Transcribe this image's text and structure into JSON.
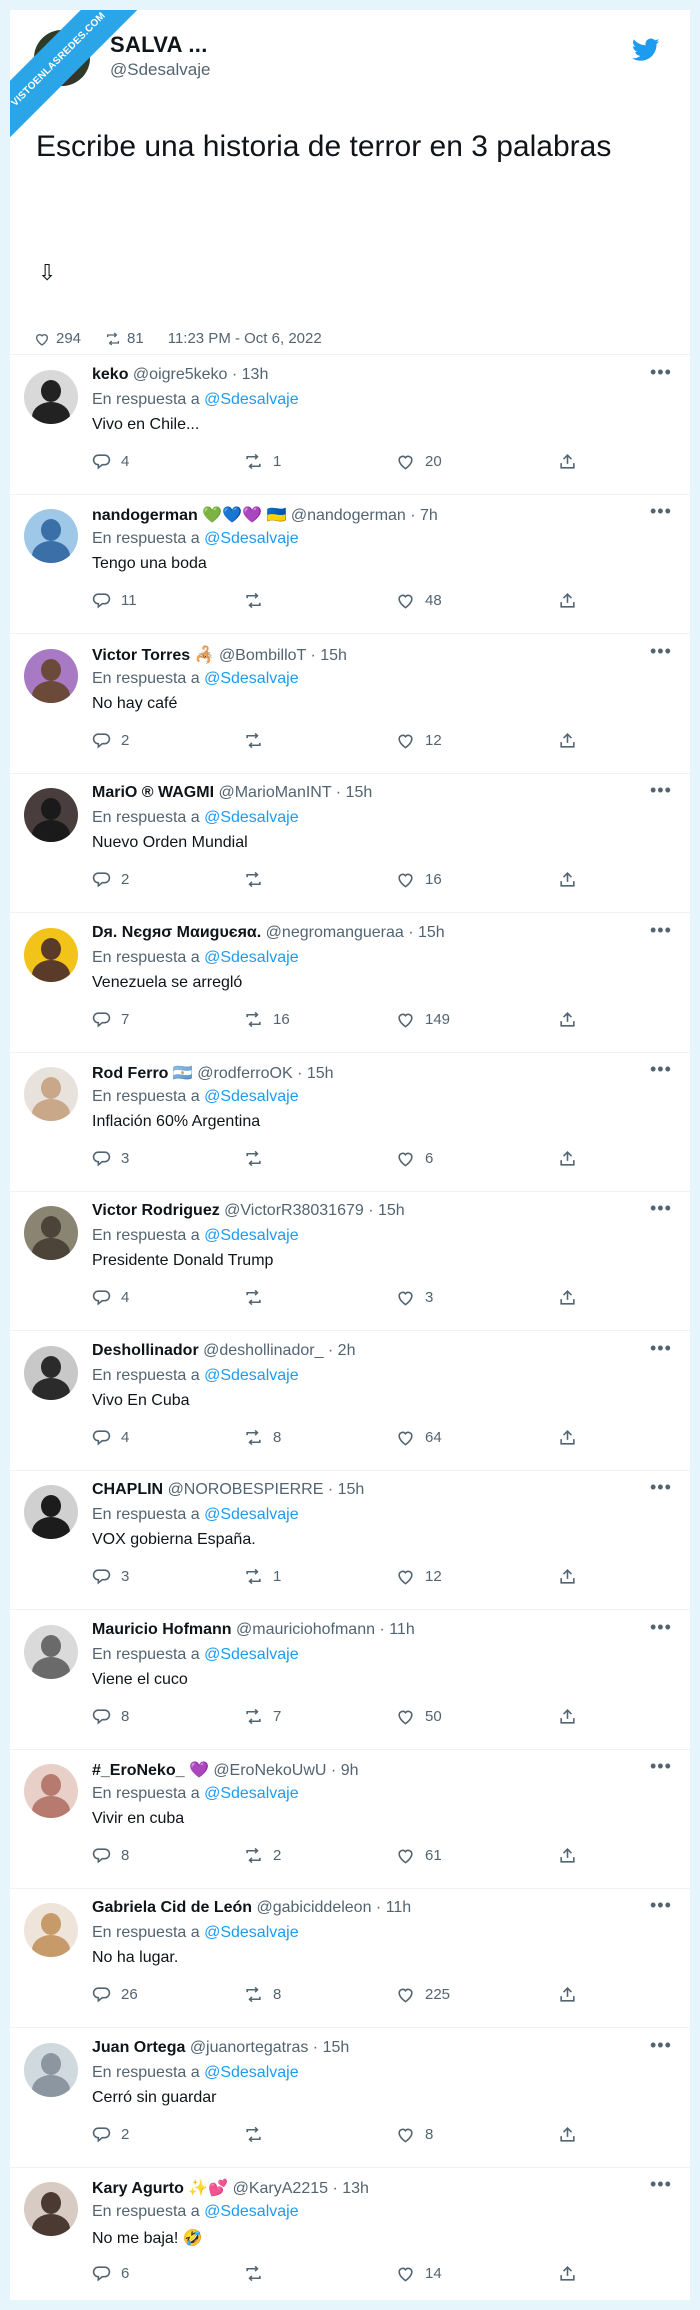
{
  "watermark": "VISTOENLASREDES.COM",
  "tweet": {
    "author_name": "SALVA ...",
    "author_handle": "@Sdesalvaje",
    "text": "Escribe una historia de terror en 3 palabras",
    "arrow": "⇩",
    "likes": "294",
    "retweets": "81",
    "timestamp": "11:23 PM - Oct 6, 2022"
  },
  "reply_prefix": "En respuesta a",
  "replies": [
    {
      "name": "keko",
      "meta": "@oigre5keko · 13h",
      "mention": "@Sdesalvaje",
      "text": "Vivo en Chile...",
      "replies": "4",
      "retweets": "1",
      "likes": "20",
      "avatar_color": "#222222",
      "avatar_bg": "#d9d9d9"
    },
    {
      "name": "nandogerman 💚💙💜 🇺🇦",
      "meta": "@nandogerman · 7h",
      "mention": "@Sdesalvaje",
      "text": "Tengo una boda",
      "replies": "11",
      "retweets": "",
      "likes": "48",
      "avatar_color": "#3a6fa8",
      "avatar_bg": "#9fc8e8"
    },
    {
      "name": "Victor Torres 🦂",
      "meta": "@BombilloT · 15h",
      "mention": "@Sdesalvaje",
      "text": "No hay café",
      "replies": "2",
      "retweets": "",
      "likes": "12",
      "avatar_color": "#6b4a3a",
      "avatar_bg": "#a97ac4"
    },
    {
      "name": "MariO ® WAGMI",
      "meta": "@MarioManINT · 15h",
      "mention": "@Sdesalvaje",
      "text": "Nuevo Orden Mundial",
      "replies": "2",
      "retweets": "",
      "likes": "16",
      "avatar_color": "#1a1a1a",
      "avatar_bg": "#4a3d3d"
    },
    {
      "name": "Dя. Nєgяσ Mαиgυєяα.",
      "meta": "@negromangueraa · 15h",
      "mention": "@Sdesalvaje",
      "text": "Venezuela se arregló",
      "replies": "7",
      "retweets": "16",
      "likes": "149",
      "avatar_color": "#5a3a28",
      "avatar_bg": "#f2c318"
    },
    {
      "name": "Rod Ferro 🇦🇷",
      "meta": "@rodferroOK · 15h",
      "mention": "@Sdesalvaje",
      "text": "Inflación 60% Argentina",
      "replies": "3",
      "retweets": "",
      "likes": "6",
      "avatar_color": "#c9a88a",
      "avatar_bg": "#e8e2dc"
    },
    {
      "name": "Victor Rodriguez",
      "meta": "@VictorR38031679 · 15h",
      "mention": "@Sdesalvaje",
      "text": "Presidente Donald Trump",
      "replies": "4",
      "retweets": "",
      "likes": "3",
      "avatar_color": "#4c4438",
      "avatar_bg": "#8a8472"
    },
    {
      "name": "Deshollinador",
      "meta": "@deshollinador_ · 2h",
      "mention": "@Sdesalvaje",
      "text": "Vivo En Cuba",
      "replies": "4",
      "retweets": "8",
      "likes": "64",
      "avatar_color": "#2b2b2b",
      "avatar_bg": "#c8c8c8"
    },
    {
      "name": "CHAPLIN",
      "meta": "@NOROBESPIERRE · 15h",
      "mention": "@Sdesalvaje",
      "text": "VOX gobierna España.",
      "replies": "3",
      "retweets": "1",
      "likes": "12",
      "avatar_color": "#1c1c1c",
      "avatar_bg": "#d0d0d0"
    },
    {
      "name": "Mauricio Hofmann",
      "meta": "@mauriciohofmann · 11h",
      "mention": "@Sdesalvaje",
      "text": "Viene el cuco",
      "replies": "8",
      "retweets": "7",
      "likes": "50",
      "avatar_color": "#6a6a6a",
      "avatar_bg": "#dadada"
    },
    {
      "name": "#_EroNeko_ 💜",
      "meta": "@EroNekoUwU · 9h",
      "mention": "@Sdesalvaje",
      "text": "Vivir en cuba",
      "replies": "8",
      "retweets": "2",
      "likes": "61",
      "avatar_color": "#b77a6e",
      "avatar_bg": "#e8cfc8"
    },
    {
      "name": "Gabriela Cid de León",
      "meta": "@gabiciddeleon · 11h",
      "mention": "@Sdesalvaje",
      "text": "No ha lugar.",
      "replies": "26",
      "retweets": "8",
      "likes": "225",
      "avatar_color": "#c79a6a",
      "avatar_bg": "#eee4da"
    },
    {
      "name": "Juan Ortega",
      "meta": "@juanortegatras · 15h",
      "mention": "@Sdesalvaje",
      "text": "Cerró sin guardar",
      "replies": "2",
      "retweets": "",
      "likes": "8",
      "avatar_color": "#8b96a0",
      "avatar_bg": "#cfd9de"
    },
    {
      "name": "Kary Agurto ✨💕",
      "meta": "@KaryA2215 · 13h",
      "mention": "@Sdesalvaje",
      "text": "No me baja! 🤣",
      "replies": "6",
      "retweets": "",
      "likes": "14",
      "avatar_color": "#4a3a32",
      "avatar_bg": "#d7cbc3"
    }
  ]
}
